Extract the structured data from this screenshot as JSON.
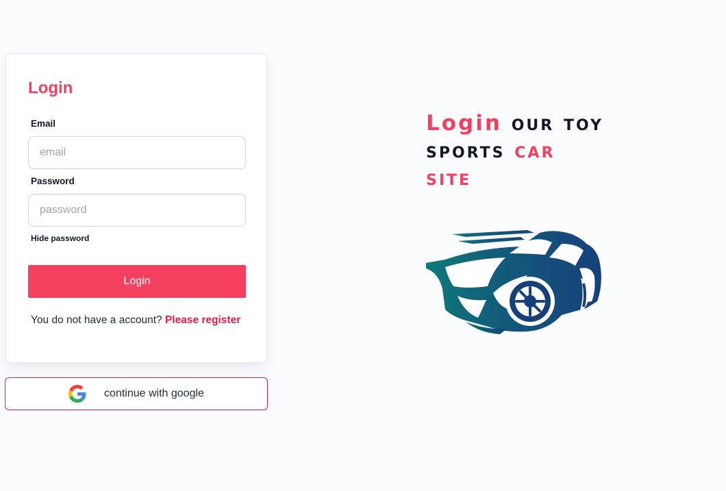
{
  "login_form": {
    "title": "Login",
    "email_label": "Email",
    "email_placeholder": "email",
    "email_value": "",
    "password_label": "Password",
    "password_placeholder": "password",
    "password_value": "",
    "toggle_password_label": "Hide password",
    "submit_label": "Login",
    "register_prompt": "You do not have a account?",
    "register_link": "Please register"
  },
  "google": {
    "icon": "google-icon",
    "label": "continue with google"
  },
  "hero": {
    "word1": "Login",
    "word2": "our toy",
    "word3": "sports",
    "word4": "car",
    "word5": "site",
    "illustration": "sports-car-logo"
  },
  "colors": {
    "accent": "#f43f5e",
    "text_dark": "#111827",
    "car_teal": "#0f6d78",
    "car_navy": "#17407a"
  }
}
